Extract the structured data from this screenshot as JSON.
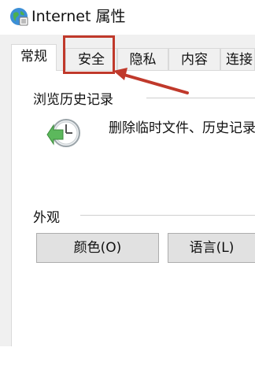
{
  "window": {
    "title": "Internet 属性",
    "icon": "internet-globe-icon"
  },
  "tabs": [
    {
      "label": "常规",
      "active": true
    },
    {
      "label": "安全",
      "active": false
    },
    {
      "label": "隐私",
      "active": false
    },
    {
      "label": "内容",
      "active": false
    },
    {
      "label": "连接",
      "active": false
    }
  ],
  "browsing_history": {
    "group_label": "浏览历史记录",
    "icon": "history-clock-icon",
    "description": "删除临时文件、历史记录"
  },
  "appearance": {
    "group_label": "外观",
    "buttons": [
      {
        "label": "颜色(O)"
      },
      {
        "label": "语言(L)"
      }
    ]
  },
  "annotation": {
    "color": "#c0392b",
    "target": "安全"
  }
}
